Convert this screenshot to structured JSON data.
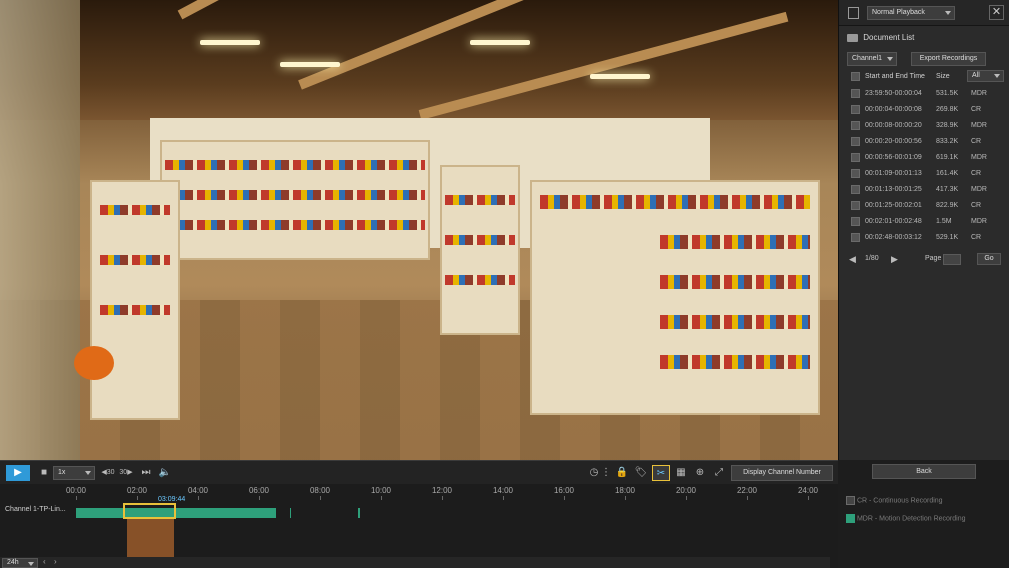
{
  "playback_mode": "Normal Playback",
  "document_list": {
    "title": "Document List",
    "channel": "Channel1",
    "export_button": "Export Recordings",
    "col_time": "Start and End Time",
    "col_size": "Size",
    "filter": "All",
    "rows": [
      {
        "time": "23:59:50-00:00:04",
        "size": "531.5K",
        "type": "MDR"
      },
      {
        "time": "00:00:04-00:00:08",
        "size": "269.8K",
        "type": "CR"
      },
      {
        "time": "00:00:08-00:00:20",
        "size": "328.9K",
        "type": "MDR"
      },
      {
        "time": "00:00:20-00:00:56",
        "size": "833.2K",
        "type": "CR"
      },
      {
        "time": "00:00:56-00:01:09",
        "size": "619.1K",
        "type": "MDR"
      },
      {
        "time": "00:01:09-00:01:13",
        "size": "161.4K",
        "type": "CR"
      },
      {
        "time": "00:01:13-00:01:25",
        "size": "417.3K",
        "type": "MDR"
      },
      {
        "time": "00:01:25-00:02:01",
        "size": "822.9K",
        "type": "CR"
      },
      {
        "time": "00:02:01-00:02:48",
        "size": "1.5M",
        "type": "MDR"
      },
      {
        "time": "00:02:48-00:03:12",
        "size": "529.1K",
        "type": "CR"
      }
    ],
    "pager": "1/80",
    "page_label": "Page",
    "go_button": "Go"
  },
  "toolbar": {
    "speed": "1x",
    "display_channel_button": "Display Channel Number"
  },
  "timeline": {
    "hours": [
      "00:00",
      "02:00",
      "04:00",
      "06:00",
      "08:00",
      "10:00",
      "12:00",
      "14:00",
      "16:00",
      "18:00",
      "20:00",
      "22:00",
      "24:00"
    ],
    "cursor_time": "03:09:44",
    "channel_label": "Channel 1-TP-Lin...",
    "zoom": "24h"
  },
  "side": {
    "back_button": "Back",
    "legend_cr": "CR - Continuous Recording",
    "legend_mdr": "MDR - Motion Detection Recording"
  },
  "colors": {
    "recording": "#2ea07b",
    "selection": "#e8c13a",
    "clip": "#9a5a2a",
    "accent": "#6ac8ff"
  }
}
